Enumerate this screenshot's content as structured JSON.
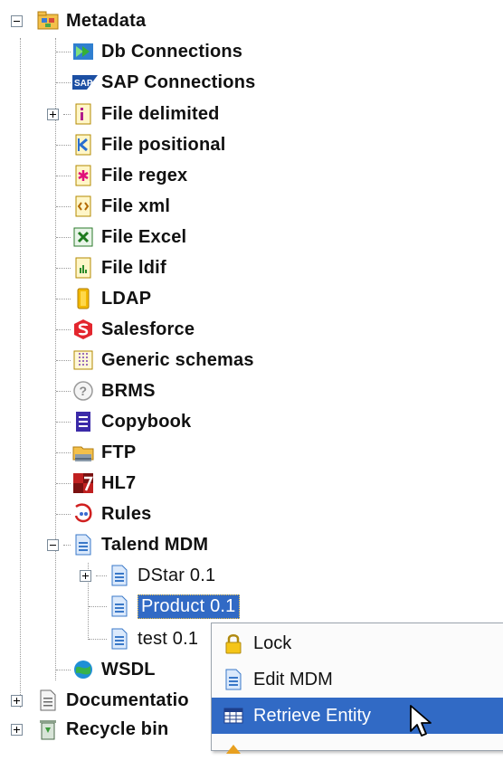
{
  "tree": {
    "metadata": "Metadata",
    "db_connections": "Db Connections",
    "sap_connections": "SAP Connections",
    "file_delimited": "File delimited",
    "file_positional": "File positional",
    "file_regex": "File regex",
    "file_xml": "File xml",
    "file_excel": "File Excel",
    "file_ldif": "File ldif",
    "ldap": "LDAP",
    "salesforce": "Salesforce",
    "generic_schemas": "Generic schemas",
    "brms": "BRMS",
    "copybook": "Copybook",
    "ftp": "FTP",
    "hl7": "HL7",
    "rules": "Rules",
    "talend_mdm": "Talend MDM",
    "dstar": "DStar 0.1",
    "product": "Product 0.1",
    "test": "test 0.1",
    "wsdl": "WSDL",
    "documentation": "Documentatio",
    "recycle_bin": "Recycle bin"
  },
  "context_menu": {
    "lock": "Lock",
    "edit_mdm": "Edit MDM",
    "retrieve_entity": "Retrieve Entity"
  },
  "icons": {
    "sap": "SAP"
  },
  "colors": {
    "selection": "#316ac5",
    "menu_highlight": "#316ac5"
  }
}
